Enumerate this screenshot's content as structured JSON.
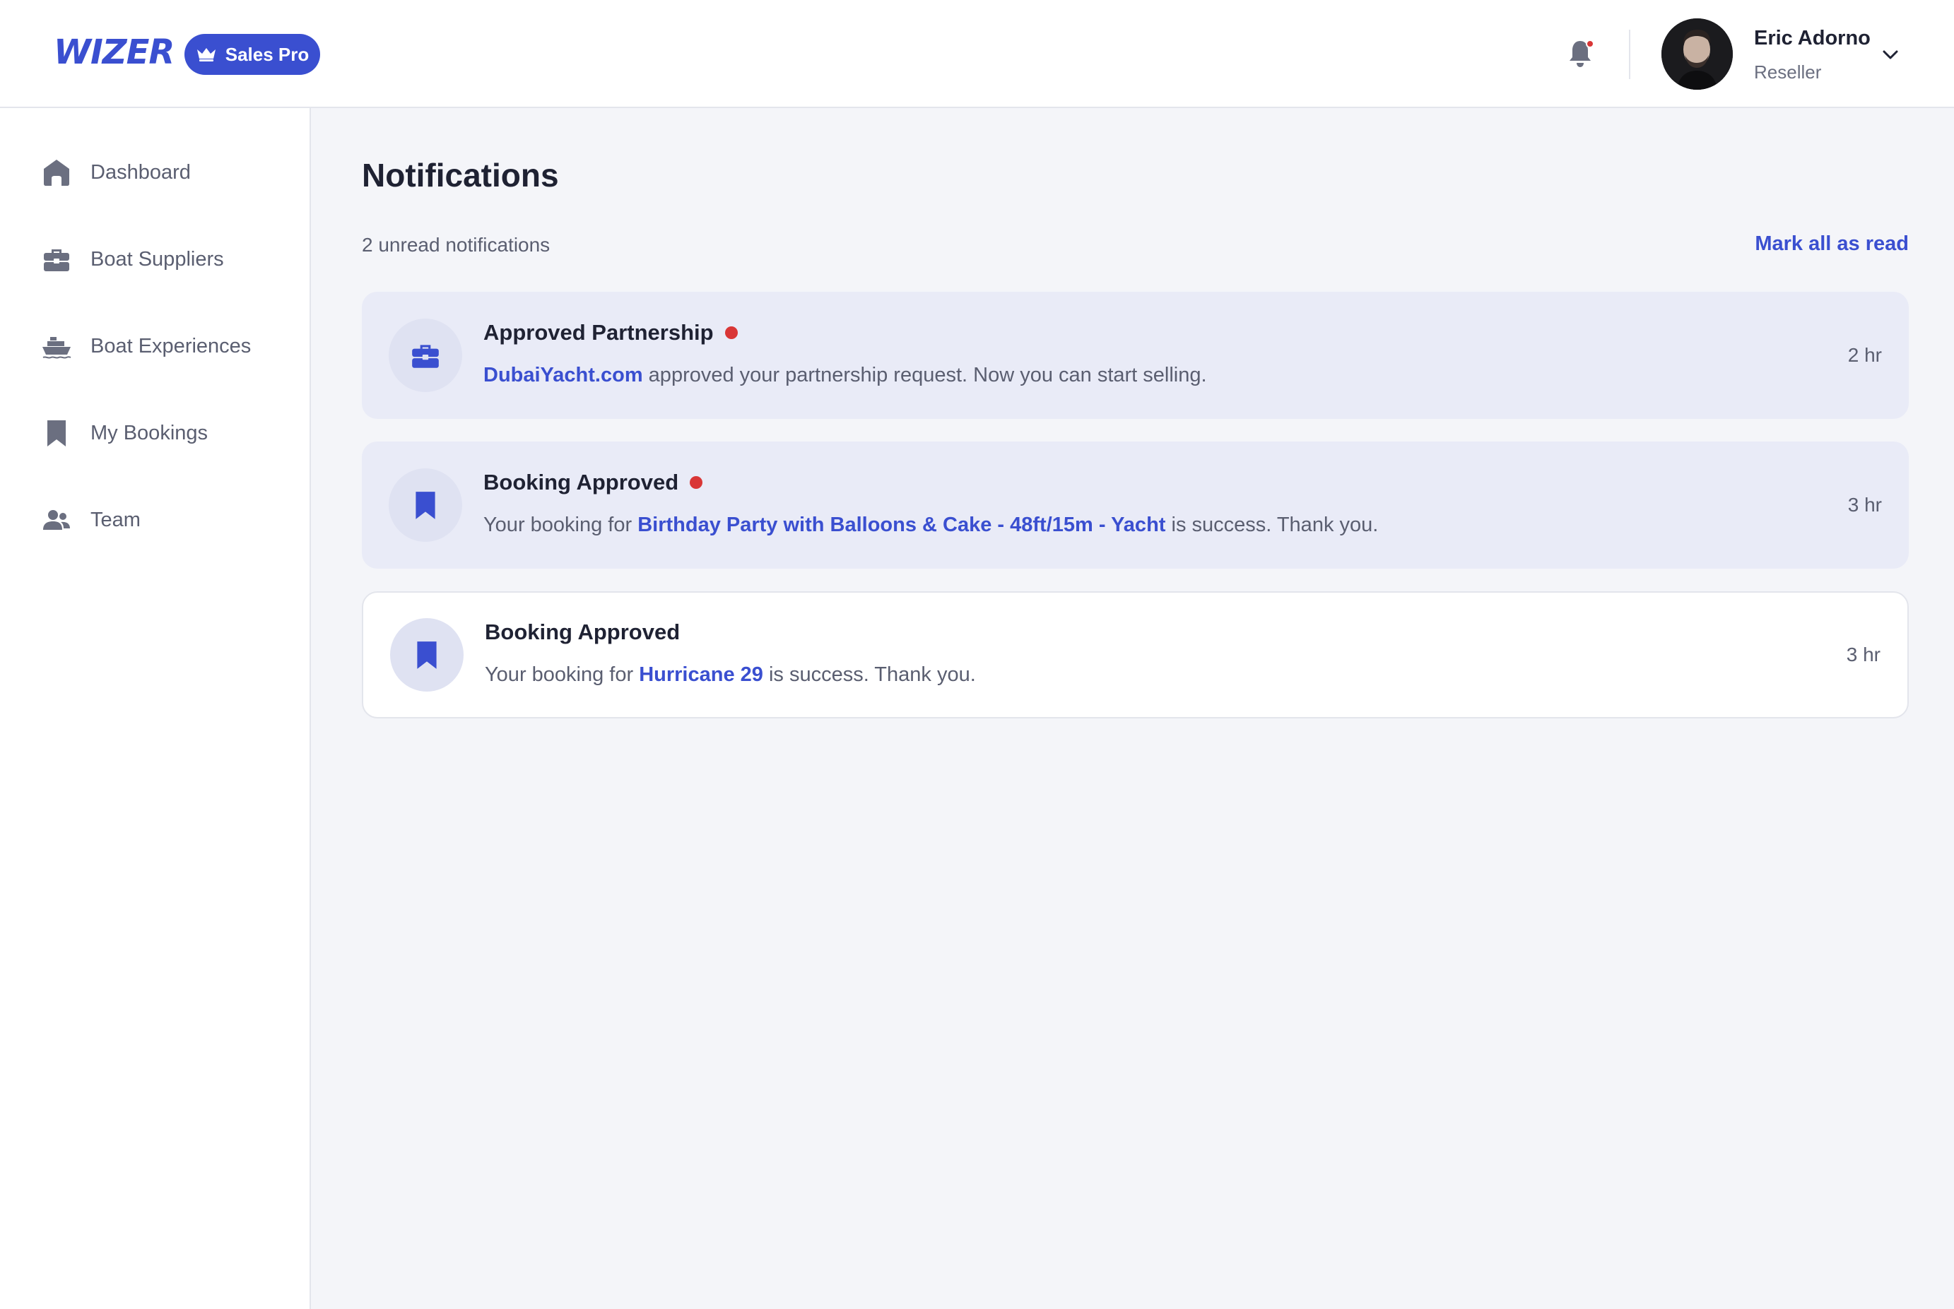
{
  "brand": {
    "logo_text": "WIZER",
    "plan_label": "Sales Pro",
    "accent": "#3a4fd0"
  },
  "header": {
    "notifications_icon": "bell-icon",
    "has_unread_indicator": true,
    "user": {
      "name": "Eric Adorno",
      "role": "Reseller"
    }
  },
  "sidebar": {
    "items": [
      {
        "label": "Dashboard",
        "icon": "home-icon"
      },
      {
        "label": "Boat Suppliers",
        "icon": "briefcase-icon"
      },
      {
        "label": "Boat Experiences",
        "icon": "ship-icon"
      },
      {
        "label": "My Bookings",
        "icon": "bookmark-icon"
      },
      {
        "label": "Team",
        "icon": "users-icon"
      }
    ]
  },
  "page": {
    "title": "Notifications",
    "unread_summary": "2 unread notifications",
    "mark_all_label": "Mark all as read"
  },
  "notifications": [
    {
      "title": "Approved Partnership",
      "unread": true,
      "icon": "briefcase-icon",
      "link_text": "DubaiYacht.com",
      "text_after": " approved your partnership request. Now you can start selling.",
      "time": "2 hr"
    },
    {
      "title": "Booking Approved",
      "unread": true,
      "icon": "bookmark-icon",
      "text_before": "Your booking for ",
      "link_text": "Birthday Party with Balloons & Cake - 48ft/15m - Yacht",
      "text_after": " is success. Thank you.",
      "time": "3 hr"
    },
    {
      "title": "Booking Approved",
      "unread": false,
      "icon": "bookmark-icon",
      "text_before": "Your booking for ",
      "link_text": "Hurricane 29",
      "text_after": " is success. Thank you.",
      "time": "3 hr"
    }
  ],
  "colors": {
    "unread_dot": "#d93636",
    "unread_card_bg": "#e9ebf7",
    "page_bg": "#f4f5f9"
  }
}
